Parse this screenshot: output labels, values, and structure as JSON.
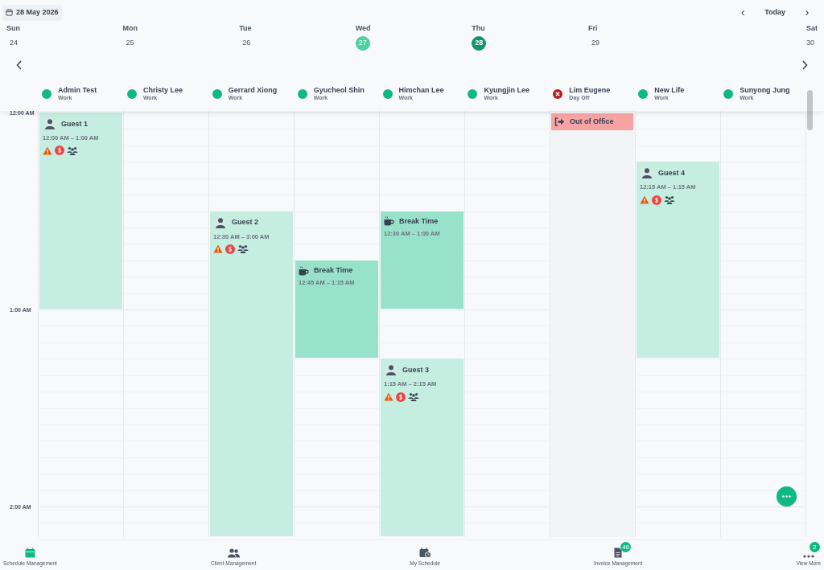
{
  "date_button": {
    "label": "28 May 2026"
  },
  "nav": {
    "prev": "‹",
    "today": "Today",
    "next": "›"
  },
  "days": [
    {
      "name": "Sun",
      "date": "24",
      "selected": false,
      "marked": false
    },
    {
      "name": "Mon",
      "date": "25",
      "selected": false,
      "marked": false
    },
    {
      "name": "Tue",
      "date": "26",
      "selected": false,
      "marked": false
    },
    {
      "name": "Wed",
      "date": "27",
      "selected": false,
      "marked": true
    },
    {
      "name": "Thu",
      "date": "28",
      "selected": true,
      "marked": false
    },
    {
      "name": "Fri",
      "date": "29",
      "selected": false,
      "marked": false
    },
    {
      "name": "Sat",
      "date": "30",
      "selected": false,
      "marked": false
    }
  ],
  "staff": [
    {
      "name": "Admin Test",
      "status": "Work",
      "kind": "work",
      "events": [
        {
          "kind": "guest",
          "title": "Guest 1",
          "time": "12:00 AM – 1:00 AM"
        }
      ]
    },
    {
      "name": "Christy Lee",
      "status": "Work",
      "kind": "work"
    },
    {
      "name": "Gerrard Xiong",
      "status": "Work",
      "kind": "work",
      "events": [
        {
          "kind": "guest",
          "title": "Guest 2",
          "time": "12:30 AM – 3:00 AM"
        }
      ]
    },
    {
      "name": "Gyucheol Shin",
      "status": "Work",
      "kind": "work",
      "events": [
        {
          "kind": "break",
          "title": "Break Time",
          "time": "12:45 AM – 1:15 AM"
        }
      ]
    },
    {
      "name": "Himchan Lee",
      "status": "Work",
      "kind": "work",
      "events": [
        {
          "kind": "break",
          "title": "Break Time",
          "time": "12:30 AM – 1:00 AM"
        },
        {
          "kind": "guest",
          "title": "Guest 3",
          "time": "1:15 AM – 2:15 AM"
        }
      ]
    },
    {
      "name": "Kyungjin Lee",
      "status": "Work",
      "kind": "work"
    },
    {
      "name": "Lim Eugene",
      "status": "Day Off",
      "kind": "off",
      "events": [
        {
          "kind": "out",
          "title": "Out of Office"
        }
      ]
    },
    {
      "name": "New Life",
      "status": "Work",
      "kind": "work",
      "events": [
        {
          "kind": "guest",
          "title": "Guest 4",
          "time": "12:15 AM – 1:15 AM"
        }
      ]
    },
    {
      "name": "Sunyong Jung",
      "status": "Work",
      "kind": "work"
    }
  ],
  "time_labels": [
    "12:00 AM",
    "1:00 AM",
    "2:00 AM"
  ],
  "bottom_nav": [
    {
      "label": "Schedule Management",
      "kind": "calendar",
      "selected": true
    },
    {
      "label": "Client Management",
      "kind": "people",
      "selected": false
    },
    {
      "label": "My Schedule",
      "kind": "schedule",
      "selected": false
    },
    {
      "label": "Invoice Management",
      "kind": "invoice",
      "selected": false,
      "badge": "46"
    },
    {
      "label": "View More",
      "kind": "more",
      "selected": false,
      "badge": "2"
    }
  ]
}
